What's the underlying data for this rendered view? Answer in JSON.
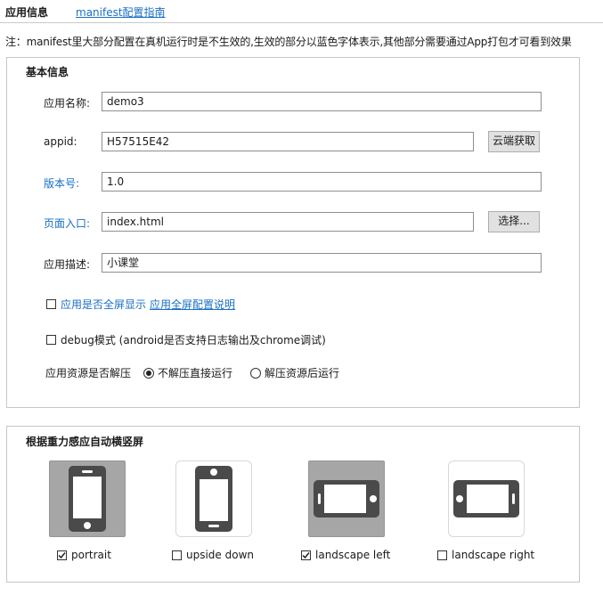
{
  "tabs": [
    {
      "label": "应用信息"
    },
    {
      "label": "manifest配置指南"
    }
  ],
  "note": "注：manifest里大部分配置在真机运行时是不生效的,生效的部分以蓝色字体表示,其他部分需要通过App打包才可看到效果",
  "basic": {
    "title": "基本信息",
    "app_name": {
      "label": "应用名称:",
      "value": "demo3"
    },
    "appid": {
      "label": "appid:",
      "value": "H57515E42",
      "button": "云端获取"
    },
    "version": {
      "label": "版本号:",
      "value": "1.0"
    },
    "entry": {
      "label": "页面入口:",
      "value": "index.html",
      "button": "选择..."
    },
    "description": {
      "label": "应用描述:",
      "value": "小课堂"
    },
    "fullscreen": {
      "label": "应用是否全屏显示",
      "link": "应用全屏配置说明",
      "checked": false
    },
    "debug": {
      "label": "debug模式 (android是否支持日志输出及chrome调试)",
      "checked": false
    },
    "decompress": {
      "label": "应用资源是否解压",
      "options": [
        {
          "label": "不解压直接运行",
          "selected": true
        },
        {
          "label": "解压资源后运行",
          "selected": false
        }
      ]
    }
  },
  "orientation": {
    "title": "根据重力感应自动横竖屏",
    "items": [
      {
        "label": "portrait",
        "checked": true,
        "icon": "phone-portrait-icon"
      },
      {
        "label": "upside down",
        "checked": false,
        "icon": "phone-upside-down-icon"
      },
      {
        "label": "landscape left",
        "checked": true,
        "icon": "phone-landscape-left-icon"
      },
      {
        "label": "landscape right",
        "checked": false,
        "icon": "phone-landscape-right-icon"
      }
    ]
  },
  "colors": {
    "link": "#1a6fc4",
    "selected_tile": "#a6a6a6",
    "phone": "#4a4a4a"
  }
}
